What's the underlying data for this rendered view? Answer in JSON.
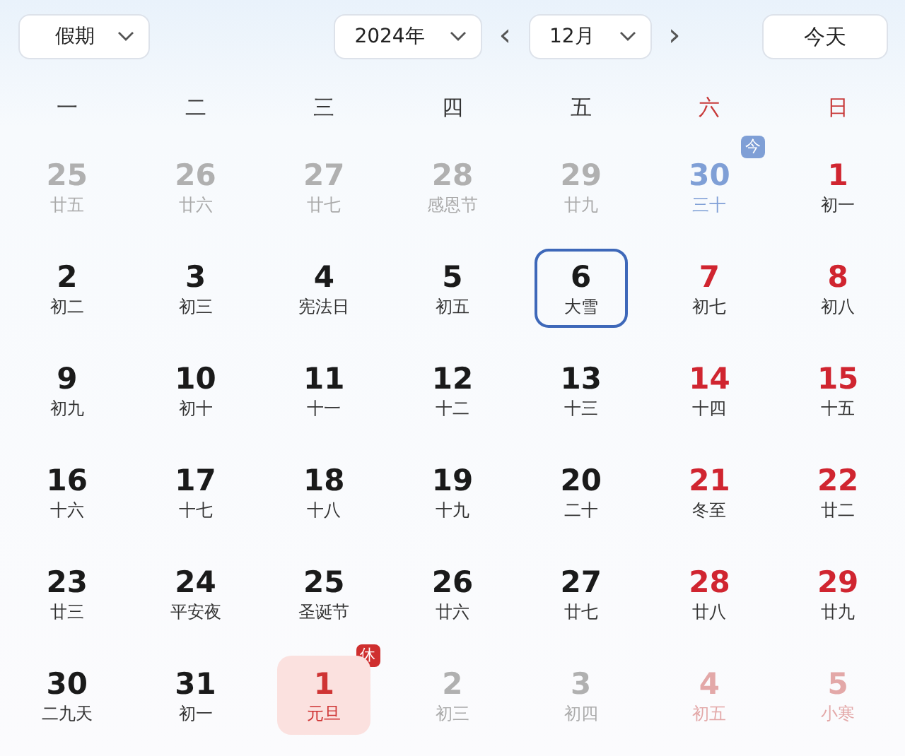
{
  "holiday_select": {
    "label": "假期"
  },
  "year_select": {
    "value": "2024年"
  },
  "prev_button": {
    "label": "‹"
  },
  "month_select": {
    "value": "12月"
  },
  "next_button": {
    "label": "›"
  },
  "today_button": {
    "label": "今天"
  },
  "weekdays": [
    {
      "label": "一",
      "weekend": false
    },
    {
      "label": "二",
      "weekend": false
    },
    {
      "label": "三",
      "weekend": false
    },
    {
      "label": "四",
      "weekend": false
    },
    {
      "label": "五",
      "weekend": false
    },
    {
      "label": "六",
      "weekend": true
    },
    {
      "label": "日",
      "weekend": true
    }
  ],
  "days": [
    {
      "day": "25",
      "lunar": "廿五",
      "in_month": false,
      "weekend": false,
      "selected": false,
      "kind": "normal"
    },
    {
      "day": "26",
      "lunar": "廿六",
      "in_month": false,
      "weekend": false,
      "selected": false,
      "kind": "normal"
    },
    {
      "day": "27",
      "lunar": "廿七",
      "in_month": false,
      "weekend": false,
      "selected": false,
      "kind": "normal"
    },
    {
      "day": "28",
      "lunar": "感恩节",
      "in_month": false,
      "weekend": false,
      "selected": false,
      "kind": "normal"
    },
    {
      "day": "29",
      "lunar": "廿九",
      "in_month": false,
      "weekend": false,
      "selected": false,
      "kind": "normal"
    },
    {
      "day": "30",
      "lunar": "三十",
      "selected": false,
      "kind": "today",
      "badge": "今"
    },
    {
      "day": "1",
      "lunar": "初一",
      "in_month": true,
      "weekend": true,
      "selected": false,
      "kind": "normal"
    },
    {
      "day": "2",
      "lunar": "初二",
      "in_month": true,
      "weekend": false,
      "selected": false,
      "kind": "normal"
    },
    {
      "day": "3",
      "lunar": "初三",
      "in_month": true,
      "weekend": false,
      "selected": false,
      "kind": "normal"
    },
    {
      "day": "4",
      "lunar": "宪法日",
      "in_month": true,
      "weekend": false,
      "selected": false,
      "kind": "normal"
    },
    {
      "day": "5",
      "lunar": "初五",
      "in_month": true,
      "weekend": false,
      "selected": false,
      "kind": "normal"
    },
    {
      "day": "6",
      "lunar": "大雪",
      "in_month": true,
      "weekend": false,
      "selected": true,
      "kind": "normal"
    },
    {
      "day": "7",
      "lunar": "初七",
      "in_month": true,
      "weekend": true,
      "selected": false,
      "kind": "normal"
    },
    {
      "day": "8",
      "lunar": "初八",
      "in_month": true,
      "weekend": true,
      "selected": false,
      "kind": "normal"
    },
    {
      "day": "9",
      "lunar": "初九",
      "in_month": true,
      "weekend": false,
      "selected": false,
      "kind": "normal"
    },
    {
      "day": "10",
      "lunar": "初十",
      "in_month": true,
      "weekend": false,
      "selected": false,
      "kind": "normal"
    },
    {
      "day": "11",
      "lunar": "十一",
      "in_month": true,
      "weekend": false,
      "selected": false,
      "kind": "normal"
    },
    {
      "day": "12",
      "lunar": "十二",
      "in_month": true,
      "weekend": false,
      "selected": false,
      "kind": "normal"
    },
    {
      "day": "13",
      "lunar": "十三",
      "in_month": true,
      "weekend": false,
      "selected": false,
      "kind": "normal"
    },
    {
      "day": "14",
      "lunar": "十四",
      "in_month": true,
      "weekend": true,
      "selected": false,
      "kind": "normal"
    },
    {
      "day": "15",
      "lunar": "十五",
      "in_month": true,
      "weekend": true,
      "selected": false,
      "kind": "normal"
    },
    {
      "day": "16",
      "lunar": "十六",
      "in_month": true,
      "weekend": false,
      "selected": false,
      "kind": "normal"
    },
    {
      "day": "17",
      "lunar": "十七",
      "in_month": true,
      "weekend": false,
      "selected": false,
      "kind": "normal"
    },
    {
      "day": "18",
      "lunar": "十八",
      "in_month": true,
      "weekend": false,
      "selected": false,
      "kind": "normal"
    },
    {
      "day": "19",
      "lunar": "十九",
      "in_month": true,
      "weekend": false,
      "selected": false,
      "kind": "normal"
    },
    {
      "day": "20",
      "lunar": "二十",
      "in_month": true,
      "weekend": false,
      "selected": false,
      "kind": "normal"
    },
    {
      "day": "21",
      "lunar": "冬至",
      "in_month": true,
      "weekend": true,
      "selected": false,
      "kind": "normal"
    },
    {
      "day": "22",
      "lunar": "廿二",
      "in_month": true,
      "weekend": true,
      "selected": false,
      "kind": "normal"
    },
    {
      "day": "23",
      "lunar": "廿三",
      "in_month": true,
      "weekend": false,
      "selected": false,
      "kind": "normal"
    },
    {
      "day": "24",
      "lunar": "平安夜",
      "in_month": true,
      "weekend": false,
      "selected": false,
      "kind": "normal"
    },
    {
      "day": "25",
      "lunar": "圣诞节",
      "in_month": true,
      "weekend": false,
      "selected": false,
      "kind": "normal"
    },
    {
      "day": "26",
      "lunar": "廿六",
      "in_month": true,
      "weekend": false,
      "selected": false,
      "kind": "normal"
    },
    {
      "day": "27",
      "lunar": "廿七",
      "in_month": true,
      "weekend": false,
      "selected": false,
      "kind": "normal"
    },
    {
      "day": "28",
      "lunar": "廿八",
      "in_month": true,
      "weekend": true,
      "selected": false,
      "kind": "normal"
    },
    {
      "day": "29",
      "lunar": "廿九",
      "in_month": true,
      "weekend": true,
      "selected": false,
      "kind": "normal"
    },
    {
      "day": "30",
      "lunar": "二九天",
      "in_month": true,
      "weekend": false,
      "selected": false,
      "kind": "normal"
    },
    {
      "day": "31",
      "lunar": "初一",
      "in_month": true,
      "weekend": false,
      "selected": false,
      "kind": "normal"
    },
    {
      "day": "1",
      "lunar": "元旦",
      "selected": false,
      "kind": "holiday",
      "badge": "休"
    },
    {
      "day": "2",
      "lunar": "初三",
      "in_month": false,
      "weekend": false,
      "selected": false,
      "kind": "normal"
    },
    {
      "day": "3",
      "lunar": "初四",
      "in_month": false,
      "weekend": false,
      "selected": false,
      "kind": "normal"
    },
    {
      "day": "4",
      "lunar": "初五",
      "in_month": false,
      "weekend": true,
      "selected": false,
      "kind": "normal"
    },
    {
      "day": "5",
      "lunar": "小寒",
      "in_month": false,
      "weekend": true,
      "selected": false,
      "kind": "normal"
    }
  ]
}
